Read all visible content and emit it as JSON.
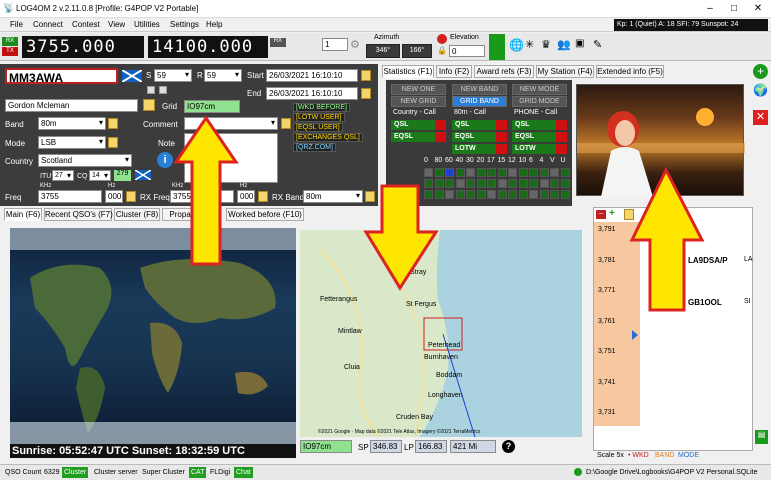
{
  "title": "LOG4OM 2 v.2.11.0.8 [Profile: G4POP V2 Portable]",
  "menu": [
    "File",
    "Connect",
    "Contest",
    "View",
    "Utilities",
    "Settings",
    "Help"
  ],
  "solar": "Kp: 1 (Quiet)  A: 18  SFI: 79  Sunspot: 24",
  "rx": "RX",
  "tx": "TX",
  "freq_rx": "3755.000",
  "freq_tx": "14100.000",
  "vfo_step": "1",
  "azimuth_label": "Azimuth",
  "azimuth_sp": "346°",
  "azimuth_lp": "166°",
  "elevation_label": "Elevation",
  "elevation_val": "0",
  "callsign": "MM3AWA",
  "rst_s_label": "S",
  "rst_s": "59",
  "rst_r_label": "R",
  "rst_r": "59",
  "start_label": "Start",
  "start": "26/03/2021 16:10:10",
  "end_label": "End",
  "end": "26/03/2021 16:10:10",
  "name": "Gordon Mcleman",
  "grid_label": "Grid",
  "grid": "IO97cm",
  "band_label": "Band",
  "band": "80m",
  "mode_label": "Mode",
  "mode": "LSB",
  "country_label": "Country",
  "country": "Scotland",
  "itu_label": "ITU",
  "itu": "27",
  "cq_label": "CQ",
  "cq": "14",
  "dxcc": "279",
  "comment_label": "Comment",
  "note_label": "Note",
  "freq_label": "Freq",
  "freq_khz": "3755",
  "freq_hz": "000",
  "khz": "KHz",
  "hz": "Hz",
  "rxfreq_label": "RX Freq",
  "rxfreq_khz": "3755",
  "rxfreq_hz": "000",
  "rxband_label": "RX Band",
  "rxband": "80m",
  "qsl_info": [
    "[WKD BEFORE]",
    "[LOTW USER]",
    "[EQSL USER]",
    "[EXCHANGES QSL]",
    "[QRZ.COM]"
  ],
  "top_tabs": [
    "Statistics (F1)",
    "Info (F2)",
    "Award refs (F3)",
    "My Station (F4)",
    "Extended info (F5)"
  ],
  "new_buttons": [
    "NEW ONE",
    "NEW BAND",
    "NEW MODE",
    "NEW GRID",
    "GRID BAND",
    "GRID MODE"
  ],
  "stat_cols": [
    "Country - Call",
    "80m - Call",
    "PHONE - Call"
  ],
  "qsl_labels": [
    "QSL",
    "EQSL",
    "LOTW"
  ],
  "band_header": [
    "0",
    "80",
    "60",
    "40",
    "30",
    "20",
    "17",
    "15",
    "12",
    "10",
    "6",
    "4",
    "V",
    "U"
  ],
  "bottom_tabs": [
    "Main (F6)",
    "Recent QSO's (F7)",
    "Cluster (F8)",
    "Propagation",
    "Worked before (F10)"
  ],
  "sun_times": "Sunrise: 05:52:47 UTC  Sunset: 18:32:59 UTC",
  "map_places": [
    "Fetterangus",
    "St Fergus",
    "Mintlaw",
    "Peterhead",
    "Burnhaven",
    "Cluia",
    "Boddam",
    "Longhaven",
    "Cruden Bay",
    "Stray"
  ],
  "map_credit": "©2021 Google · Map data ©2021 Tele Atlas, Imagery ©2021 TerraMetrics",
  "bottom_grid": "IO97cm",
  "sp_label": "SP",
  "sp": "346.83",
  "lp_label": "LP",
  "lp": "166.83",
  "dist": "421 Mi",
  "bandmap_ticks": [
    "3,791",
    "3,781",
    "3,771",
    "3,761",
    "3,751",
    "3,741",
    "3,731"
  ],
  "bandmap_spots": [
    "LA9DSA/P",
    "GB1OOL"
  ],
  "scale": "Scale 5x",
  "legend_wkd": "• WKD",
  "legend_band": "BAND",
  "legend_mode": "MODE",
  "qso_count_label": "QSO Count",
  "qso_count": "6329",
  "status_buttons": [
    "Cluster",
    "Cluster server",
    "Super Cluster",
    "CAT",
    "FLDigi",
    "Chat"
  ],
  "db_path": "D:\\Google Drive\\Logbooks\\G4POP V2 Personal.SQLite"
}
